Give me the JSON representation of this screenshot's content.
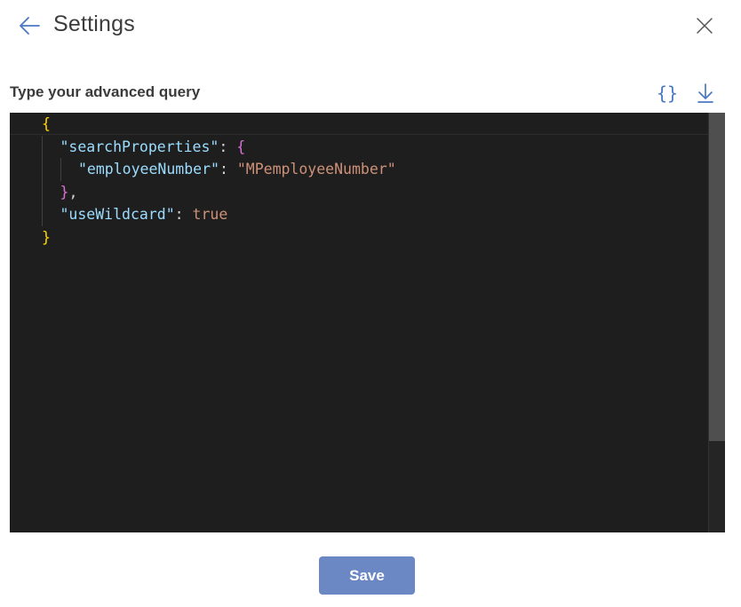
{
  "header": {
    "title": "Settings",
    "back_icon": "arrow-left-icon",
    "close_icon": "close-icon"
  },
  "query": {
    "label": "Type your advanced query",
    "format_icon": "curly-braces-icon",
    "format_glyph": "{}",
    "download_icon": "download-icon"
  },
  "editor": {
    "lines": [
      {
        "indent": 0,
        "tokens": [
          {
            "t": "{",
            "c": "brace-y"
          }
        ]
      },
      {
        "indent": 1,
        "tokens": [
          {
            "t": "\"searchProperties\"",
            "c": "key"
          },
          {
            "t": ": ",
            "c": "punc"
          },
          {
            "t": "{",
            "c": "brace-p"
          }
        ]
      },
      {
        "indent": 2,
        "tokens": [
          {
            "t": "\"employeeNumber\"",
            "c": "key"
          },
          {
            "t": ": ",
            "c": "punc"
          },
          {
            "t": "\"MPemployeeNumber\"",
            "c": "str"
          }
        ]
      },
      {
        "indent": 1,
        "tokens": [
          {
            "t": "}",
            "c": "brace-p"
          },
          {
            "t": ",",
            "c": "punc"
          }
        ]
      },
      {
        "indent": 1,
        "tokens": [
          {
            "t": "\"useWildcard\"",
            "c": "key"
          },
          {
            "t": ": ",
            "c": "punc"
          },
          {
            "t": "true",
            "c": "bool"
          }
        ]
      },
      {
        "indent": 0,
        "tokens": [
          {
            "t": "}",
            "c": "brace-y"
          }
        ]
      }
    ]
  },
  "footer": {
    "save_label": "Save"
  },
  "colors": {
    "accent": "#6b87c4",
    "icon_blue": "#4a78c2",
    "editor_bg": "#1e1e1e"
  }
}
